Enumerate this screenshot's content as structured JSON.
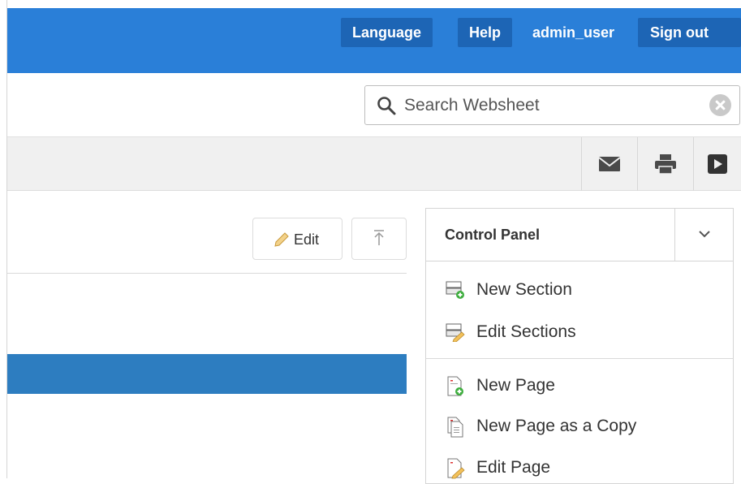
{
  "header": {
    "language_label": "Language",
    "help_label": "Help",
    "username": "admin_user",
    "signout_label": "Sign out"
  },
  "search": {
    "placeholder": "Search Websheet"
  },
  "toolbar": {
    "icons": [
      "mail-icon",
      "print-icon",
      "play-icon"
    ]
  },
  "content": {
    "edit_label": "Edit"
  },
  "control_panel": {
    "title": "Control Panel",
    "items": [
      {
        "label": "New Section",
        "icon": "new-section-icon"
      },
      {
        "label": "Edit Sections",
        "icon": "edit-sections-icon"
      },
      {
        "label": "New Page",
        "icon": "new-page-icon"
      },
      {
        "label": "New Page as a Copy",
        "icon": "copy-page-icon"
      },
      {
        "label": "Edit Page",
        "icon": "edit-page-icon"
      }
    ]
  },
  "colors": {
    "header_bg": "#2a7fd8",
    "header_button": "#1d65b5",
    "content_bar": "#2d7dc0"
  }
}
